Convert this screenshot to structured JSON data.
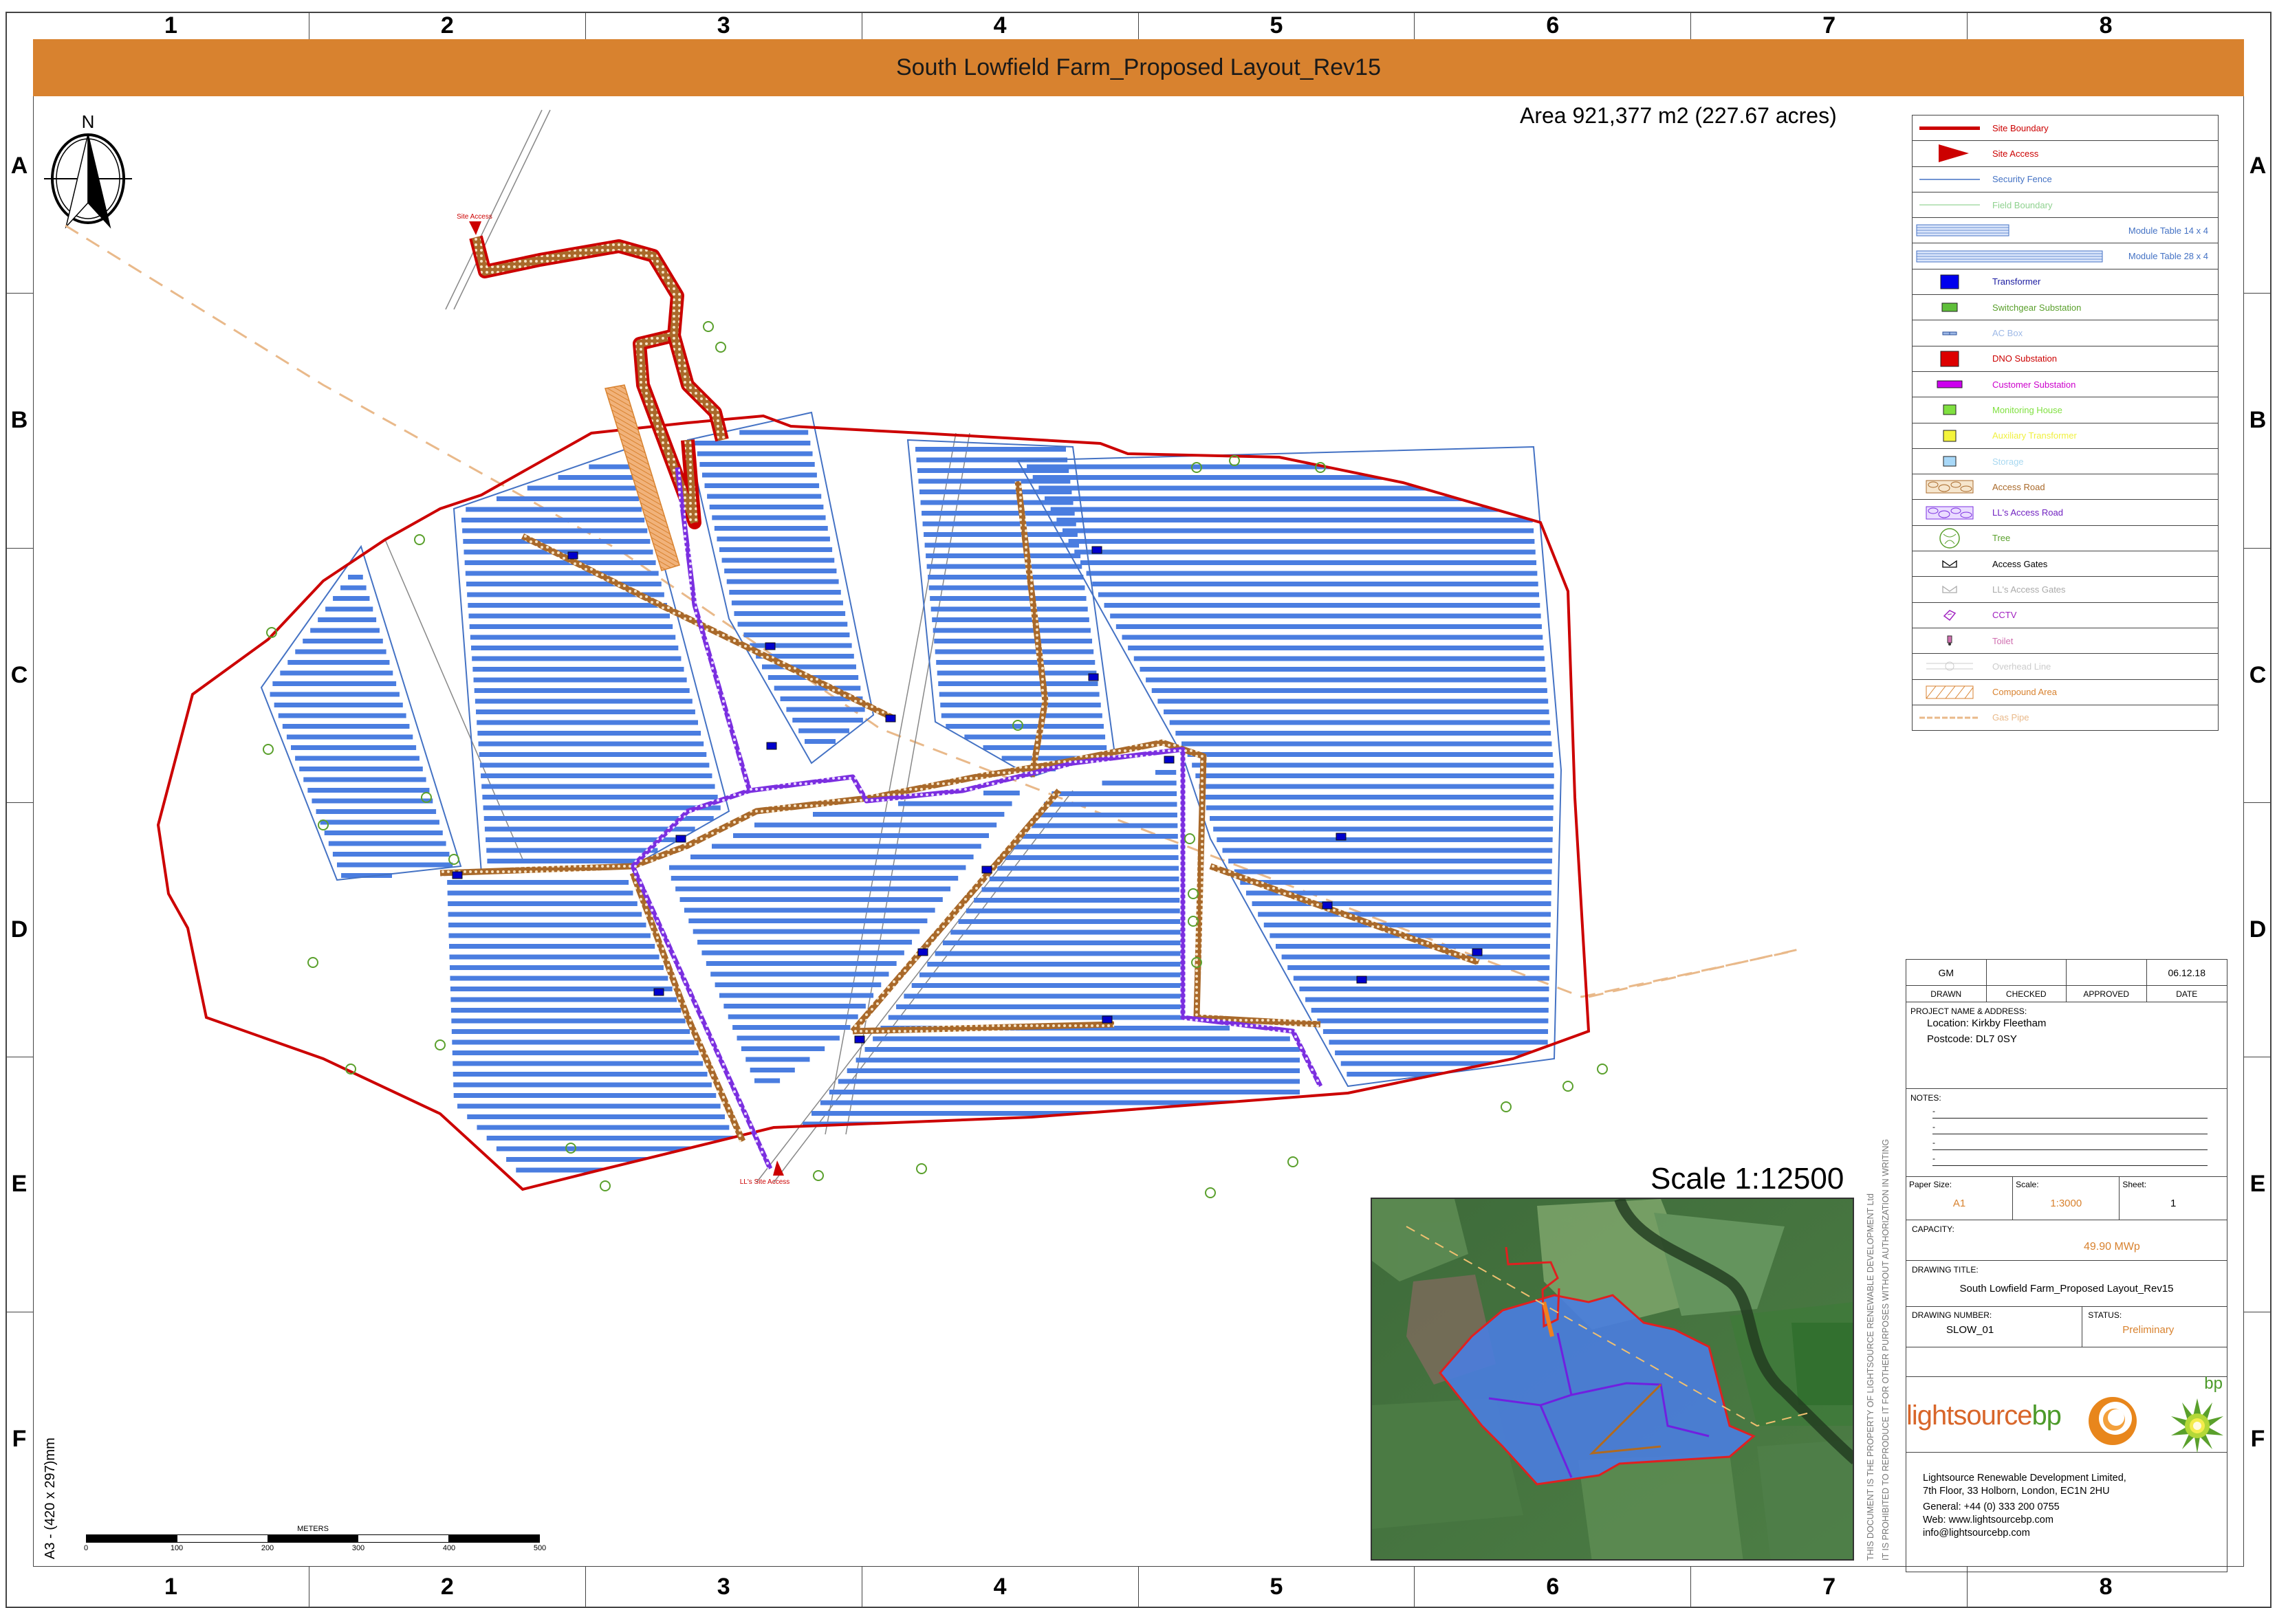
{
  "title": "South Lowfield Farm_Proposed Layout_Rev15",
  "area_text": "Area 921,377 m2 (227.67 acres)",
  "grid": {
    "columns": [
      "1",
      "2",
      "3",
      "4",
      "5",
      "6",
      "7",
      "8"
    ],
    "rows": [
      "A",
      "B",
      "C",
      "D",
      "E",
      "F"
    ]
  },
  "north_arrow": {
    "label": "N"
  },
  "colors": {
    "title_bar": "#d8822f",
    "site_boundary": "#cc0000",
    "security_fence": "#4472c4",
    "field_boundary": "#8fd18f",
    "module": "#4a7de0",
    "access_road": "#a9692a",
    "ll_access_road": "#7b2fe0",
    "gas_pipe": "#e9b98a"
  },
  "legend": [
    {
      "symbol": "site-boundary-line",
      "label": "Site Boundary",
      "color": "#cc0000"
    },
    {
      "symbol": "site-access-triangle",
      "label": "Site Access",
      "color": "#cc0000"
    },
    {
      "symbol": "security-fence-line",
      "label": "Security Fence",
      "color": "#4472c4"
    },
    {
      "symbol": "field-boundary-line",
      "label": "Field Boundary",
      "color": "#8fd18f"
    },
    {
      "symbol": "module-table-14x4",
      "label": "Module Table 14 x 4",
      "color": "#4472c4"
    },
    {
      "symbol": "module-table-28x4",
      "label": "Module Table 28 x 4",
      "color": "#4472c4"
    },
    {
      "symbol": "transformer-square",
      "label": "Transformer",
      "color": "#1a1aa0"
    },
    {
      "symbol": "switchgear-square",
      "label": "Switchgear Substation",
      "color": "#5aa02c"
    },
    {
      "symbol": "ac-box",
      "label": "AC Box",
      "color": "#9db8e6"
    },
    {
      "symbol": "dno-square",
      "label": "DNO Substation",
      "color": "#cc0000"
    },
    {
      "symbol": "customer-rect",
      "label": "Customer Substation",
      "color": "#cc00cc"
    },
    {
      "symbol": "monitoring-square",
      "label": "Monitoring House",
      "color": "#80e040"
    },
    {
      "symbol": "aux-transformer-square",
      "label": "Auxiliary Transformer",
      "color": "#f0f040"
    },
    {
      "symbol": "storage-square",
      "label": "Storage",
      "color": "#a8d8f0"
    },
    {
      "symbol": "access-road-hatch",
      "label": "Access Road",
      "color": "#a9692a"
    },
    {
      "symbol": "ll-access-road-hatch",
      "label": "LL's Access Road",
      "color": "#7020c0"
    },
    {
      "symbol": "tree",
      "label": "Tree",
      "color": "#5aa02c"
    },
    {
      "symbol": "access-gates",
      "label": "Access Gates",
      "color": "#000000"
    },
    {
      "symbol": "ll-access-gates",
      "label": "LL's Access Gates",
      "color": "#aaaaaa"
    },
    {
      "symbol": "cctv",
      "label": "CCTV",
      "color": "#a020c0"
    },
    {
      "symbol": "toilet",
      "label": "Toilet",
      "color": "#d070b0"
    },
    {
      "symbol": "overhead-line",
      "label": "Overhead Line",
      "color": "#cccccc"
    },
    {
      "symbol": "compound-area-hatch",
      "label": "Compound Area",
      "color": "#d8822f"
    },
    {
      "symbol": "gas-pipe-dashed",
      "label": "Gas Pipe",
      "color": "#e9b98a"
    }
  ],
  "map_labels": {
    "site_access": "Site Access",
    "ll_site_access": "LL's Site Access"
  },
  "title_block": {
    "drawn_value": "GM",
    "checked_value": "",
    "approved_value": "",
    "date_value": "06.12.18",
    "drawn_label": "DRAWN",
    "checked_label": "CHECKED",
    "approved_label": "APPROVED",
    "date_label": "DATE",
    "project_label": "PROJECT NAME & ADDRESS:",
    "location": "Location: Kirkby Fleetham",
    "postcode": "Postcode: DL7 0SY",
    "notes_label": "NOTES:",
    "notes": [
      "-",
      "-",
      "-",
      "-"
    ],
    "paper_size_label": "Paper Size:",
    "paper_size_value": "A1",
    "scale_label": "Scale:",
    "scale_value": "1:3000",
    "sheet_label": "Sheet:",
    "sheet_value": "1",
    "capacity_label": "CAPACITY:",
    "capacity_value": "49.90 MWp",
    "drawing_title_label": "DRAWING TITLE:",
    "drawing_title_value": "South Lowfield Farm_Proposed Layout_Rev15",
    "drawing_number_label": "DRAWING NUMBER:",
    "drawing_number_value": "SLOW_01",
    "status_label": "STATUS:",
    "status_value": "Preliminary",
    "logo_text_main": "lightsource",
    "logo_text_bp": "bp",
    "bp_mark_text": "bp",
    "company_line1": "Lightsource Renewable Development Limited,",
    "company_line2": "7th Floor, 33 Holborn, London, EC1N 2HU",
    "phone": "General: +44 (0) 333 200 0755",
    "web": "Web: www.lightsourcebp.com",
    "email": "info@lightsourcebp.com"
  },
  "disclaimer": {
    "line1": "THIS DOCUMENT IS THE PROPERTY OF LIGHTSOURCE RENEWABLE DEVELOPMENT Ltd",
    "line2": "IT IS PROHIBITED TO REPRODUCE IT FOR OTHER PURPOSES WITHOUT AUTHORIZATION IN WRITING"
  },
  "inset": {
    "scale_text": "Scale 1:12500"
  },
  "paper_size_note": "A3 - (420 x 297)mm",
  "scale_bar": {
    "unit_label": "METERS",
    "ticks": [
      "0",
      "100",
      "200",
      "300",
      "400",
      "500"
    ]
  }
}
